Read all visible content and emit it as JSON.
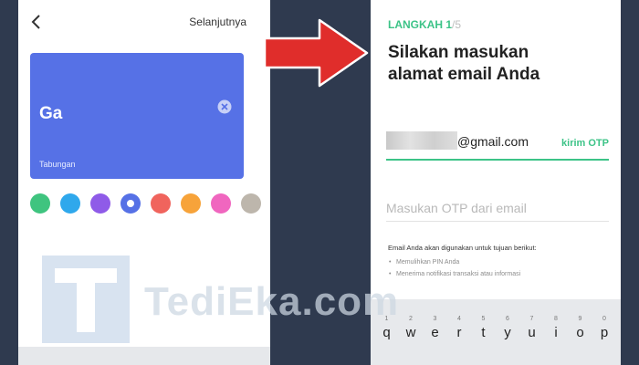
{
  "left_screen": {
    "next_label": "Selanjutnya",
    "card": {
      "name": "Ga",
      "type_label": "Tabungan",
      "color": "#5671e6"
    },
    "swatches": [
      {
        "color": "#3fc47f",
        "selected": false
      },
      {
        "color": "#2fa8ec",
        "selected": false
      },
      {
        "color": "#8f5be8",
        "selected": false
      },
      {
        "color": "#5671e6",
        "selected": true
      },
      {
        "color": "#f0645d",
        "selected": false
      },
      {
        "color": "#f7a33a",
        "selected": false
      },
      {
        "color": "#f066bf",
        "selected": false
      },
      {
        "color": "#bdb6ac",
        "selected": false
      }
    ]
  },
  "right_screen": {
    "step_current": "LANGKAH 1",
    "step_total": "/5",
    "title_line1": "Silakan masukan",
    "title_line2": "alamat email Anda",
    "email_value": "@gmail.com",
    "otp_button": "kirim OTP",
    "otp_placeholder": "Masukan OTP dari email",
    "notice_heading": "Email Anda akan digunakan untuk tujuan berikut:",
    "notice_items": [
      "Memulihkan PIN Anda",
      "Menerima notifikasi transaksi atau informasi"
    ],
    "keyboard": {
      "numbers": [
        "1",
        "2",
        "3",
        "4",
        "5",
        "6",
        "7",
        "8",
        "9",
        "0"
      ],
      "letters": [
        "q",
        "w",
        "e",
        "r",
        "t",
        "y",
        "u",
        "i",
        "o",
        "p"
      ]
    }
  },
  "watermark": {
    "text": "TediEka.com"
  },
  "colors": {
    "accent_green": "#3cc387",
    "arrow_red": "#e02d2b",
    "background": "#2f3a4f"
  }
}
